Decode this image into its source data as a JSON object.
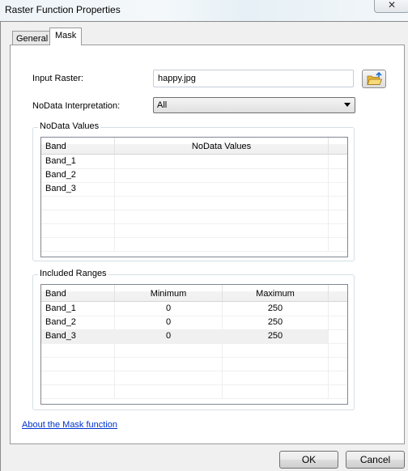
{
  "window": {
    "title": "Raster Function Properties",
    "close_label": "✕"
  },
  "tabs": [
    {
      "label": "General",
      "active": false
    },
    {
      "label": "Mask",
      "active": true
    }
  ],
  "form": {
    "input_raster_label": "Input Raster:",
    "input_raster_value": "happy.jpg",
    "nodata_interp_label": "NoData Interpretation:",
    "nodata_interp_value": "All",
    "browse_icon": "open-folder-icon"
  },
  "nodata_group": {
    "title": "NoData Values",
    "columns": [
      "Band",
      "NoData Values"
    ],
    "rows": [
      {
        "band": "Band_1",
        "value": ""
      },
      {
        "band": "Band_2",
        "value": ""
      },
      {
        "band": "Band_3",
        "value": ""
      }
    ]
  },
  "ranges_group": {
    "title": "Included Ranges",
    "columns": [
      "Band",
      "Minimum",
      "Maximum"
    ],
    "rows": [
      {
        "band": "Band_1",
        "min": "0",
        "max": "250"
      },
      {
        "band": "Band_2",
        "min": "0",
        "max": "250"
      },
      {
        "band": "Band_3",
        "min": "0",
        "max": "250",
        "selected": true
      }
    ]
  },
  "help_link": "About the Mask function",
  "buttons": {
    "ok": "OK",
    "cancel": "Cancel"
  }
}
